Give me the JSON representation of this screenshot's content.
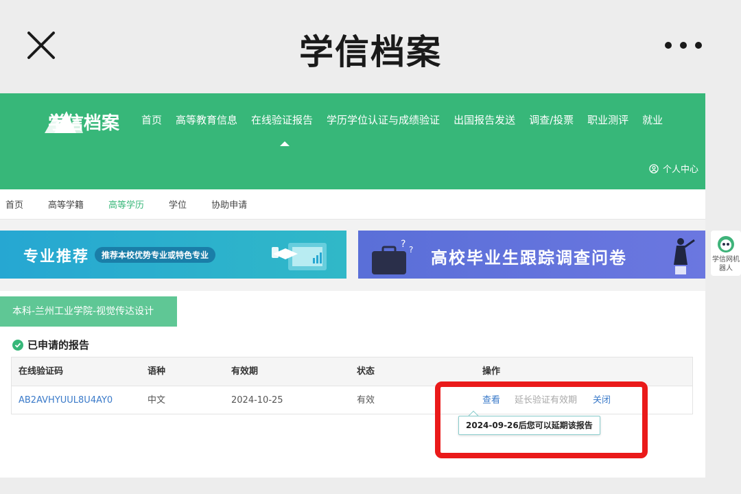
{
  "header": {
    "title": "学信档案"
  },
  "site": {
    "logo_text": "学信档案",
    "nav": [
      "首页",
      "高等教育信息",
      "在线验证报告",
      "学历学位认证与成绩验证",
      "出国报告发送",
      "调查/投票",
      "职业测评",
      "就业"
    ],
    "personal_center": "个人中心"
  },
  "sub_nav": [
    "首页",
    "高等学籍",
    "高等学历",
    "学位",
    "协助申请"
  ],
  "banners": {
    "left_title": "专业推荐",
    "left_pill": "推荐本校优势专业或特色专业",
    "right_title": "高校毕业生跟踪调查问卷"
  },
  "robot": {
    "label": "学信网机器人"
  },
  "card": {
    "tab": "本科-兰州工业学院-视觉传达设计",
    "section_title": "已申请的报告",
    "columns": [
      "在线验证码",
      "语种",
      "有效期",
      "状态",
      "操作"
    ],
    "row": {
      "code": "AB2AVHYUUL8U4AY0",
      "language": "中文",
      "expiry": "2024-10-25",
      "status": "有效",
      "op_view": "查看",
      "op_extend": "延长验证有效期",
      "op_close": "关闭"
    },
    "tooltip": "2024-09-26后您可以延期该报告"
  },
  "colors": {
    "brand_green": "#37b779",
    "link_blue": "#3a7ac9",
    "highlight_red": "#ea1a1a"
  }
}
